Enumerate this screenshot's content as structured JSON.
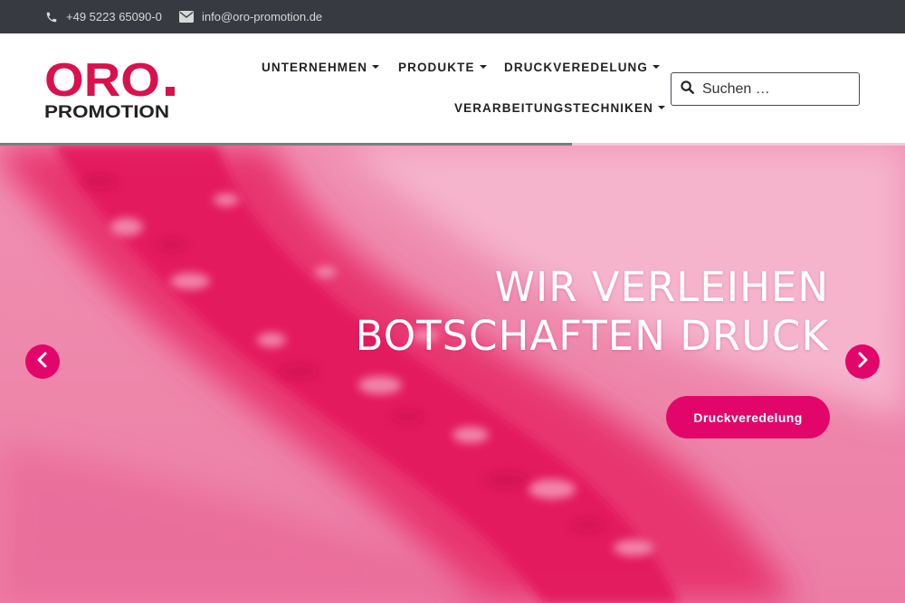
{
  "topbar": {
    "phone": "+49 5223 65090-0",
    "email": "info@oro-promotion.de",
    "phone_icon": "phone-icon",
    "email_icon": "envelope-icon"
  },
  "logo": {
    "word": "ORO",
    "dot": ".",
    "subtitle": "PROMOTION",
    "color_primary": "#d9114d",
    "color_secondary": "#222222"
  },
  "nav": {
    "items": [
      {
        "label": "UNTERNEHMEN"
      },
      {
        "label": "PRODUKTE"
      },
      {
        "label": "DRUCKVEREDELUNG"
      },
      {
        "label": "VERARBEITUNGSTECHNIKEN"
      }
    ]
  },
  "search": {
    "placeholder": "Suchen …",
    "icon": "search-icon"
  },
  "slider": {
    "progress": 0.632,
    "headline_line1": "WIR VERLEIHEN",
    "headline_line2": "BOTSCHAFTEN DRUCK",
    "cta_label": "Druckveredelung",
    "prev_icon": "chevron-left-icon",
    "next_icon": "chevron-right-icon",
    "accent_color": "#e2066a"
  }
}
